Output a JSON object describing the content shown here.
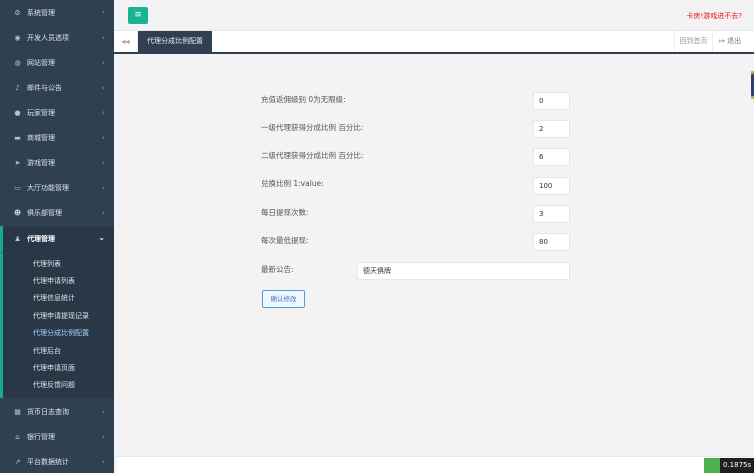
{
  "sidebar": {
    "items": [
      {
        "label": "系统管理",
        "icon": "gears-icon",
        "glyph": "⚙"
      },
      {
        "label": "开发人员选项",
        "icon": "gamepad-icon",
        "glyph": "◉"
      },
      {
        "label": "网站管理",
        "icon": "globe-icon",
        "glyph": "◍"
      },
      {
        "label": "邮件与公告",
        "icon": "bell-icon",
        "glyph": "♪"
      },
      {
        "label": "玩家管理",
        "icon": "user-icon",
        "glyph": "●"
      },
      {
        "label": "商城管理",
        "icon": "cart-icon",
        "glyph": "▬"
      },
      {
        "label": "游戏管理",
        "icon": "send-icon",
        "glyph": "➤"
      },
      {
        "label": "大厅功能管理",
        "icon": "desktop-icon",
        "glyph": "▭"
      },
      {
        "label": "俱乐部管理",
        "icon": "users-icon",
        "glyph": "☻"
      },
      {
        "label": "代理管理",
        "icon": "user-secret-icon",
        "glyph": "♟"
      }
    ],
    "agent_submenu": [
      "代理列表",
      "代理申请列表",
      "代理信息统计",
      "代理申请提现记录",
      "代理分成比例配置",
      "代理后台",
      "代理申请页面",
      "代理反馈问题"
    ],
    "bottom_items": [
      {
        "label": "货币日志查询",
        "icon": "calendar-icon",
        "glyph": "▦"
      },
      {
        "label": "银行管理",
        "icon": "bank-icon",
        "glyph": "⌂"
      },
      {
        "label": "平台数据统计",
        "icon": "line-chart-icon",
        "glyph": "↗"
      }
    ]
  },
  "topbar": {
    "menu_glyph": "≡",
    "right_link": "卡房!游戏进不去?"
  },
  "tabs": {
    "back_glyph": "◂◂",
    "active": "代理分成比例配置",
    "home": "回到首页",
    "logout_glyph": "↦",
    "logout": "退出"
  },
  "form": {
    "fields": [
      {
        "label": "充值返佣级别 0为无限级:",
        "value": "0"
      },
      {
        "label": "一级代理获得分成比例 百分比:",
        "value": "2"
      },
      {
        "label": "二级代理获得分成比例 百分比:",
        "value": "6"
      },
      {
        "label": "兑换比例 1:value:",
        "value": "100"
      },
      {
        "label": "每日提现次数:",
        "value": "3"
      },
      {
        "label": "每次最低提现:",
        "value": "80"
      }
    ],
    "notice_label": "最新公告:",
    "notice_value": "德天俱牌",
    "submit": "确认修改"
  },
  "status": {
    "timer": "0.1875s"
  }
}
